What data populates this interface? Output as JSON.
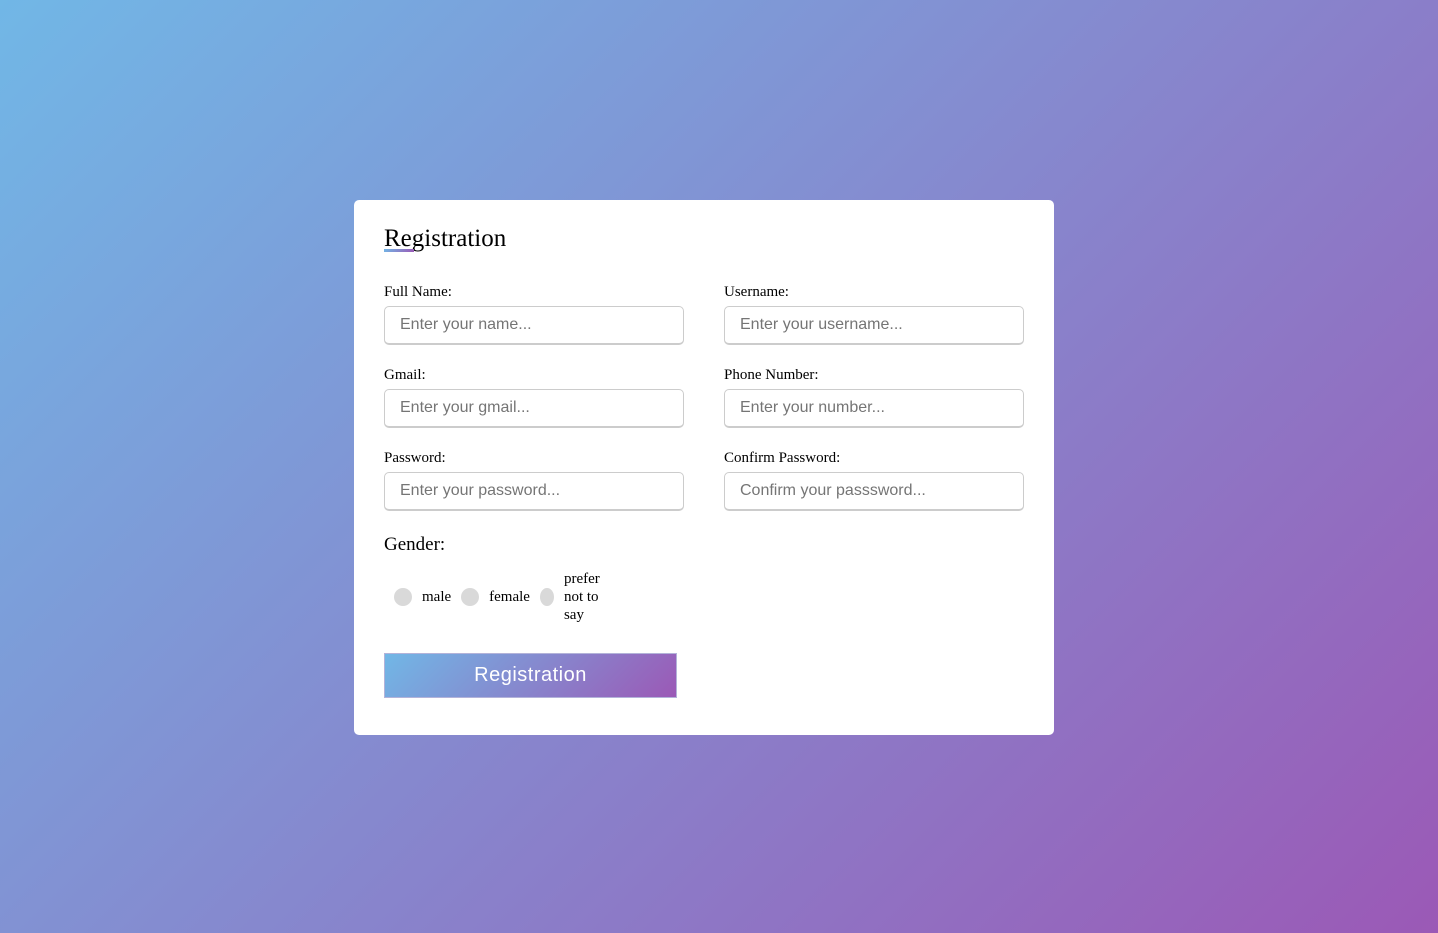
{
  "form": {
    "title": "Registration",
    "fields": [
      {
        "label": "Full Name:",
        "placeholder": "Enter your name...",
        "value": ""
      },
      {
        "label": "Username:",
        "placeholder": "Enter your username...",
        "value": ""
      },
      {
        "label": "Gmail:",
        "placeholder": "Enter your gmail...",
        "value": ""
      },
      {
        "label": "Phone Number:",
        "placeholder": "Enter your number...",
        "value": ""
      },
      {
        "label": "Password:",
        "placeholder": "Enter your password...",
        "value": ""
      },
      {
        "label": "Confirm Password:",
        "placeholder": "Confirm your passsword...",
        "value": ""
      }
    ],
    "gender": {
      "title": "Gender:",
      "options": [
        "male",
        "female",
        "prefer not to say"
      ]
    },
    "submit_label": "Registration"
  },
  "colors": {
    "gradient_start": "#71b7e6",
    "gradient_end": "#9b59b6"
  }
}
